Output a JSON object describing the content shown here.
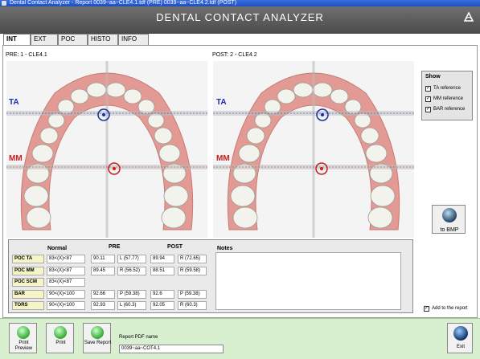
{
  "window": {
    "title": "Dental Contact Analyzer - Report  0039~aa~CLE4.1.tdf (PRE)  0039~aa~CLE4.2.tdf (POST)"
  },
  "header": {
    "title": "DENTAL CONTACT ANALYZER"
  },
  "tabs": [
    {
      "label": "INT",
      "active": true
    },
    {
      "label": "EXT",
      "active": false
    },
    {
      "label": "POC",
      "active": false
    },
    {
      "label": "HISTO",
      "active": false
    },
    {
      "label": "INFO",
      "active": false
    }
  ],
  "pre": {
    "label": "PRE:  1 - CLE4.1"
  },
  "post": {
    "label": "POST:  2 - CLE4.2"
  },
  "references": {
    "ta": "TA",
    "mm": "MM"
  },
  "show": {
    "title": "Show",
    "items": [
      {
        "label": "TA reference",
        "checked": true
      },
      {
        "label": "MM reference",
        "checked": true
      },
      {
        "label": "BAR reference",
        "checked": true
      }
    ]
  },
  "bmp_button": {
    "label": "to BMP"
  },
  "table": {
    "headers": {
      "normal": "Normal",
      "pre": "PRE",
      "post": "POST",
      "notes": "Notes"
    },
    "rows": [
      {
        "name": "POC TA",
        "normal": "83<(X)<87",
        "pre_val": "90.11",
        "pre_side": "L (57.77)",
        "post_val": "89.94",
        "post_side": "R (72.65)"
      },
      {
        "name": "POC MM",
        "normal": "83<(X)<87",
        "pre_val": "89.45",
        "pre_side": "R (56.52)",
        "post_val": "88.51",
        "post_side": "R (59.58)"
      },
      {
        "name": "POC SCM",
        "normal": "83<(X)<87",
        "pre_val": "",
        "pre_side": "",
        "post_val": "",
        "post_side": ""
      },
      {
        "name": "BAR",
        "normal": "90<(X)<100",
        "pre_val": "92.66",
        "pre_side": "P (59.38)",
        "post_val": "92.6",
        "post_side": "P (59.38)"
      },
      {
        "name": "TORS",
        "normal": "90<(X)<100",
        "pre_val": "92.93",
        "pre_side": "L (60.3)",
        "post_val": "92.05",
        "post_side": "R (60.3)"
      }
    ]
  },
  "add_report": {
    "label": "Add to the report",
    "checked": true
  },
  "bottom": {
    "print_preview": "Print Preview",
    "print": "Print",
    "save_report": "Save Report",
    "pdf_label": "Report PDF name",
    "pdf_value": "0039~aa~COT4.1",
    "exit": "Exit"
  },
  "colors": {
    "accent_blue": "#1a2fa8",
    "accent_red": "#c81e1e",
    "gum": "#e49a94"
  }
}
